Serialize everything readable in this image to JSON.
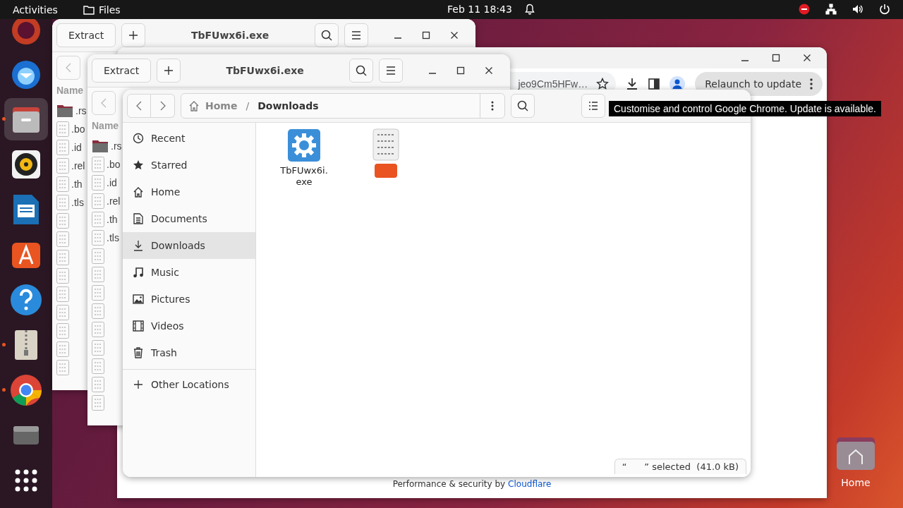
{
  "top_bar": {
    "activities": "Activities",
    "app": "Files",
    "clock": "Feb 11  18:43"
  },
  "dock": [
    {
      "kind": "ubuntu",
      "running": false,
      "selected": false
    },
    {
      "kind": "mail",
      "running": false,
      "selected": false
    },
    {
      "kind": "files",
      "running": true,
      "selected": true
    },
    {
      "kind": "music",
      "running": false,
      "selected": false
    },
    {
      "kind": "writer",
      "running": false,
      "selected": false
    },
    {
      "kind": "store",
      "running": false,
      "selected": false
    },
    {
      "kind": "help",
      "running": false,
      "selected": false
    },
    {
      "kind": "archive",
      "running": true,
      "selected": false
    },
    {
      "kind": "browser",
      "running": true,
      "selected": false
    },
    {
      "kind": "drive",
      "running": false,
      "selected": false
    },
    {
      "kind": "grid",
      "running": false,
      "selected": false
    }
  ],
  "archive_windows": [
    {
      "extract": "Extract",
      "title": "TbFUwx6i.exe",
      "name_header": "Name",
      "rows": [
        {
          "kind": "folder",
          "name": ".rs"
        },
        {
          "kind": "file",
          "name": ".bo"
        },
        {
          "kind": "file",
          "name": ".id"
        },
        {
          "kind": "file",
          "name": ".rel"
        },
        {
          "kind": "file",
          "name": ".th"
        },
        {
          "kind": "file",
          "name": ".tls"
        }
      ]
    },
    {
      "extract": "Extract",
      "title": "TbFUwx6i.exe",
      "name_header": "Name",
      "rows": [
        {
          "kind": "folder",
          "name": ".rs"
        },
        {
          "kind": "file",
          "name": ".bo"
        },
        {
          "kind": "file",
          "name": ".id"
        },
        {
          "kind": "file",
          "name": ".rel"
        },
        {
          "kind": "file",
          "name": ".th"
        },
        {
          "kind": "file",
          "name": ".tls"
        }
      ]
    }
  ],
  "chrome": {
    "address": "jeo9Cm5HFw…",
    "relaunch": "Relaunch to update",
    "footer_text": "Performance & security by",
    "footer_link": "Cloudflare"
  },
  "files": {
    "path": [
      "Home",
      "Downloads"
    ],
    "path_separator": "/",
    "sidebar": [
      {
        "kind": "recent",
        "label": "Recent",
        "selected": false
      },
      {
        "kind": "starred",
        "label": "Starred",
        "selected": false
      },
      {
        "kind": "home",
        "label": "Home",
        "selected": false
      },
      {
        "kind": "documents",
        "label": "Documents",
        "selected": false
      },
      {
        "kind": "downloads",
        "label": "Downloads",
        "selected": true
      },
      {
        "kind": "music",
        "label": "Music",
        "selected": false
      },
      {
        "kind": "pictures",
        "label": "Pictures",
        "selected": false
      },
      {
        "kind": "videos",
        "label": "Videos",
        "selected": false
      },
      {
        "kind": "trash",
        "label": "Trash",
        "selected": false
      }
    ],
    "other_locations": "Other Locations",
    "items": [
      {
        "kind": "executable",
        "name": "TbFUwx6i.exe",
        "selected": false
      },
      {
        "kind": "binary",
        "selected": true
      }
    ],
    "status": "“      ” selected  (41.0 kB)"
  },
  "tooltip": "Customise and control Google Chrome. Update is available.",
  "desktop_icon": {
    "label": "Home"
  }
}
